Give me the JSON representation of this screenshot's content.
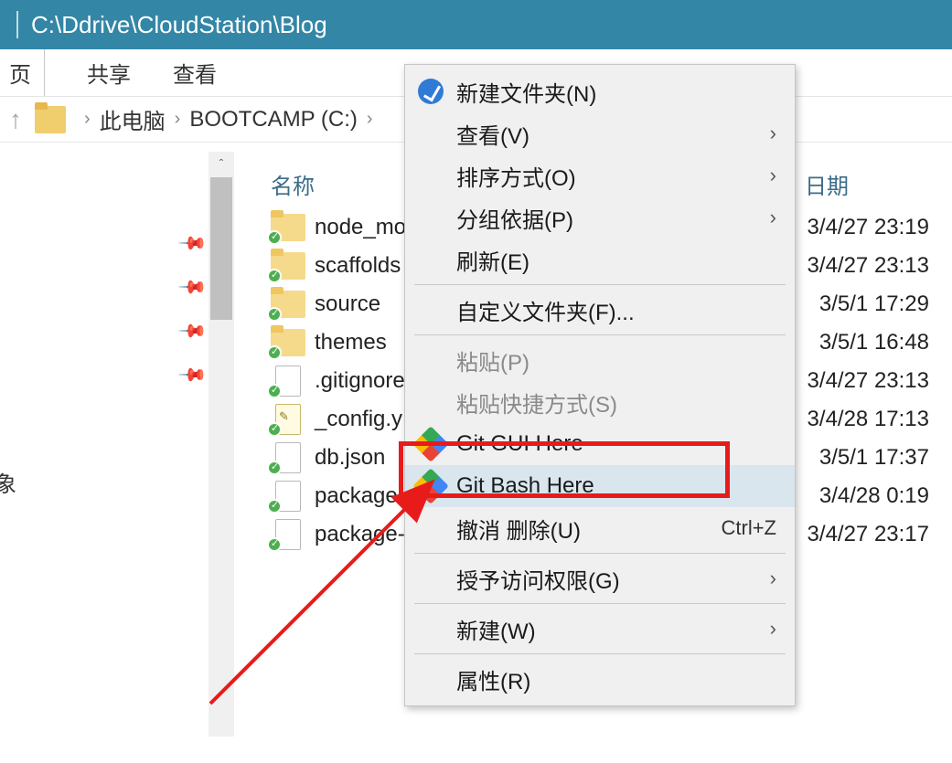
{
  "titlebar": {
    "path": "C:\\Ddrive\\CloudStation\\Blog"
  },
  "ribbon": {
    "tab1": "页",
    "tab2": "共享",
    "tab3": "查看"
  },
  "breadcrumb": {
    "loc1": "此电脑",
    "loc2": "BOOTCAMP (C:)"
  },
  "columns": {
    "name": "名称",
    "date_partial": "日期"
  },
  "left_text": {
    "t1": "",
    "t2": "象"
  },
  "files": [
    {
      "name": "node_mo",
      "date": "3/4/27 23:19",
      "type": "folder"
    },
    {
      "name": "scaffolds",
      "date": "3/4/27 23:13",
      "type": "folder"
    },
    {
      "name": "source",
      "date": "3/5/1 17:29",
      "type": "folder"
    },
    {
      "name": "themes",
      "date": "3/5/1 16:48",
      "type": "folder"
    },
    {
      "name": ".gitignore",
      "date": "3/4/27 23:13",
      "type": "file"
    },
    {
      "name": "_config.y",
      "date": "3/4/28 17:13",
      "type": "yml"
    },
    {
      "name": "db.json",
      "date": "3/5/1 17:37",
      "type": "file"
    },
    {
      "name": "package.",
      "date": "3/4/28 0:19",
      "type": "file"
    },
    {
      "name": "package-",
      "date": "3/4/27 23:17",
      "type": "file"
    }
  ],
  "ctx": {
    "new_folder": "新建文件夹(N)",
    "view": "查看(V)",
    "sort": "排序方式(O)",
    "group": "分组依据(P)",
    "refresh": "刷新(E)",
    "custom_folder": "自定义文件夹(F)...",
    "paste": "粘贴(P)",
    "paste_shortcut": "粘贴快捷方式(S)",
    "git_gui": "Git GUI Here",
    "git_bash": "Git Bash Here",
    "undo_delete": "撤消 删除(U)",
    "undo_shortcut": "Ctrl+Z",
    "grant_access": "授予访问权限(G)",
    "new": "新建(W)",
    "properties": "属性(R)"
  }
}
